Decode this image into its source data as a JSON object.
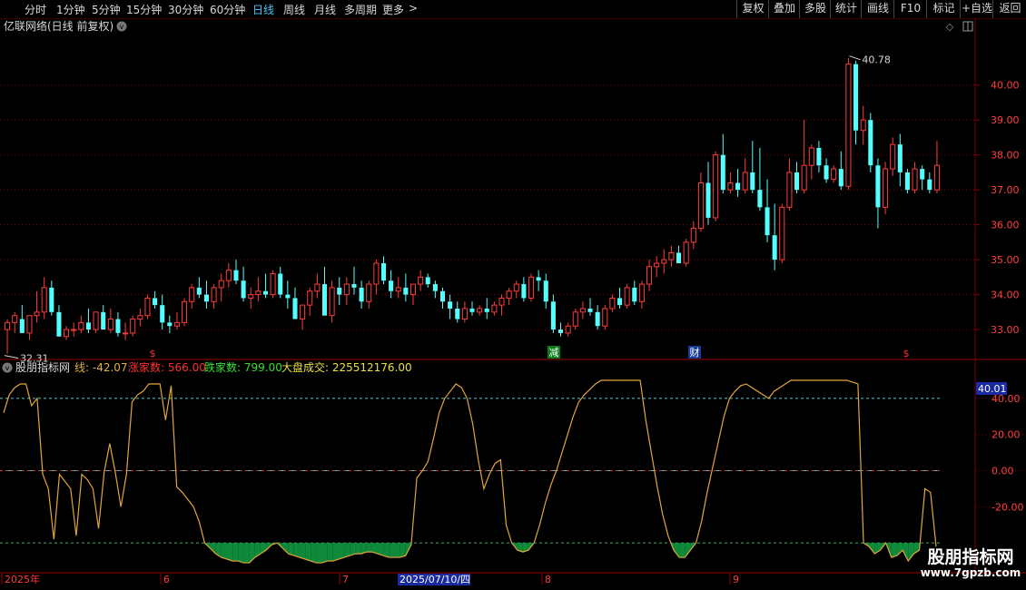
{
  "toolbar": {
    "periods": [
      {
        "label": "分时",
        "active": false
      },
      {
        "label": "1分钟",
        "active": false
      },
      {
        "label": "5分钟",
        "active": false
      },
      {
        "label": "15分钟",
        "active": false
      },
      {
        "label": "30分钟",
        "active": false
      },
      {
        "label": "60分钟",
        "active": false
      },
      {
        "label": "日线",
        "active": true
      },
      {
        "label": "周线",
        "active": false
      },
      {
        "label": "月线",
        "active": false
      },
      {
        "label": "多周期",
        "active": false
      },
      {
        "label": "更多",
        "active": false
      }
    ],
    "more_arrow": ">",
    "buttons": [
      "复权",
      "叠加",
      "多股",
      "统计",
      "画线",
      "F10",
      "标记",
      "+自选",
      "返回"
    ]
  },
  "main_panel": {
    "title": "亿联网络(日线 前复权)",
    "high_marker": "40.78",
    "low_marker": "32.31",
    "events": [
      {
        "label": "$",
        "color": "#ff3030"
      },
      {
        "label": "减",
        "color": "#00c000"
      },
      {
        "label": "财",
        "color": "#3a8bff"
      },
      {
        "label": "$",
        "color": "#ff3030"
      }
    ]
  },
  "indicator_panel": {
    "name": "股朋指标网",
    "items": [
      {
        "label": "线: -42.07",
        "color": "#e0b040"
      },
      {
        "label": "涨家数: 566.00",
        "color": "#ff3030"
      },
      {
        "label": "跌家数: 799.00",
        "color": "#30e030"
      },
      {
        "label": "大盘成交: 225512176.00",
        "color": "#e8e040"
      }
    ],
    "current_value": "40.01"
  },
  "time_axis": {
    "labels": [
      "2025年",
      "6",
      "7",
      "8",
      "9"
    ],
    "cursor_date": "2025/07/10/四"
  },
  "watermark": {
    "title": "股朋指标网",
    "url": "www.7gpzb.com"
  },
  "chart_data": [
    {
      "type": "candlestick",
      "title": "亿联网络(日线 前复权)",
      "ylim": [
        32.3,
        41.5
      ],
      "yticks": [
        33.0,
        34.0,
        35.0,
        36.0,
        37.0,
        38.0,
        39.0,
        40.0
      ],
      "colors": {
        "up": "#ff3c3c",
        "down": "#54ffff"
      },
      "ohlc": [
        [
          33.0,
          33.3,
          32.31,
          33.2
        ],
        [
          33.2,
          33.5,
          32.9,
          33.4
        ],
        [
          33.3,
          33.7,
          32.9,
          32.9
        ],
        [
          32.9,
          33.4,
          32.7,
          33.4
        ],
        [
          33.4,
          34.1,
          33.2,
          33.5
        ],
        [
          33.5,
          34.5,
          33.3,
          34.2
        ],
        [
          34.2,
          34.4,
          33.4,
          33.5
        ],
        [
          33.5,
          33.7,
          32.8,
          32.8
        ],
        [
          32.8,
          33.1,
          32.7,
          33.0
        ],
        [
          33.0,
          33.2,
          32.8,
          33.0
        ],
        [
          33.0,
          33.4,
          32.9,
          33.2
        ],
        [
          33.2,
          33.6,
          32.9,
          33.0
        ],
        [
          33.0,
          33.5,
          32.9,
          33.5
        ],
        [
          33.5,
          33.7,
          33.0,
          33.0
        ],
        [
          33.0,
          33.6,
          32.9,
          33.3
        ],
        [
          33.3,
          33.5,
          32.8,
          32.9
        ],
        [
          32.9,
          33.2,
          32.7,
          32.9
        ],
        [
          32.9,
          33.4,
          32.8,
          33.3
        ],
        [
          33.3,
          33.6,
          33.1,
          33.4
        ],
        [
          33.4,
          34.0,
          33.3,
          33.9
        ],
        [
          33.9,
          34.1,
          33.6,
          33.7
        ],
        [
          33.7,
          34.0,
          33.0,
          33.2
        ],
        [
          33.2,
          33.4,
          32.9,
          33.1
        ],
        [
          33.1,
          33.5,
          33.0,
          33.2
        ],
        [
          33.2,
          33.9,
          33.1,
          33.8
        ],
        [
          33.8,
          34.3,
          33.6,
          34.2
        ],
        [
          34.2,
          34.5,
          33.9,
          34.0
        ],
        [
          34.0,
          34.4,
          33.6,
          33.8
        ],
        [
          33.8,
          34.3,
          33.6,
          34.2
        ],
        [
          34.2,
          34.6,
          33.8,
          34.4
        ],
        [
          34.4,
          34.9,
          34.2,
          34.7
        ],
        [
          34.7,
          35.0,
          34.3,
          34.4
        ],
        [
          34.4,
          34.8,
          33.8,
          33.9
        ],
        [
          33.9,
          34.2,
          33.6,
          34.0
        ],
        [
          34.0,
          34.5,
          33.8,
          34.1
        ],
        [
          34.1,
          34.6,
          33.9,
          34.0
        ],
        [
          34.0,
          34.7,
          33.9,
          34.6
        ],
        [
          34.6,
          34.8,
          33.9,
          34.0
        ],
        [
          34.0,
          34.4,
          33.6,
          33.9
        ],
        [
          33.9,
          34.2,
          33.3,
          33.3
        ],
        [
          33.3,
          33.7,
          33.0,
          33.7
        ],
        [
          33.7,
          34.2,
          33.4,
          34.1
        ],
        [
          34.1,
          34.6,
          33.9,
          34.3
        ],
        [
          34.3,
          34.8,
          33.4,
          33.4
        ],
        [
          33.4,
          34.4,
          33.2,
          34.2
        ],
        [
          34.2,
          34.5,
          33.7,
          34.0
        ],
        [
          34.0,
          34.5,
          33.7,
          34.3
        ],
        [
          34.3,
          34.8,
          34.0,
          34.2
        ],
        [
          34.2,
          34.4,
          33.6,
          33.8
        ],
        [
          33.8,
          34.4,
          33.6,
          34.3
        ],
        [
          34.3,
          35.0,
          34.0,
          34.9
        ],
        [
          34.9,
          35.1,
          34.3,
          34.4
        ],
        [
          34.4,
          34.7,
          33.9,
          34.1
        ],
        [
          34.1,
          34.5,
          33.9,
          34.2
        ],
        [
          34.2,
          34.6,
          33.8,
          34.0
        ],
        [
          34.0,
          34.3,
          33.7,
          34.3
        ],
        [
          34.3,
          34.7,
          34.1,
          34.5
        ],
        [
          34.5,
          34.6,
          34.2,
          34.3
        ],
        [
          34.3,
          34.4,
          33.9,
          34.1
        ],
        [
          34.1,
          34.2,
          33.6,
          33.8
        ],
        [
          33.8,
          34.0,
          33.3,
          33.6
        ],
        [
          33.6,
          33.8,
          33.2,
          33.3
        ],
        [
          33.3,
          33.8,
          33.2,
          33.6
        ],
        [
          33.6,
          33.8,
          33.4,
          33.5
        ],
        [
          33.5,
          33.7,
          33.4,
          33.6
        ],
        [
          33.6,
          33.9,
          33.3,
          33.5
        ],
        [
          33.5,
          33.8,
          33.4,
          33.7
        ],
        [
          33.7,
          34.0,
          33.4,
          33.9
        ],
        [
          33.9,
          34.2,
          33.7,
          34.1
        ],
        [
          34.1,
          34.4,
          33.9,
          34.3
        ],
        [
          34.3,
          34.5,
          33.8,
          33.9
        ],
        [
          33.9,
          34.6,
          33.8,
          34.5
        ],
        [
          34.5,
          34.7,
          34.1,
          34.4
        ],
        [
          34.4,
          34.6,
          33.6,
          33.8
        ],
        [
          33.8,
          34.0,
          32.9,
          33.0
        ],
        [
          33.0,
          33.2,
          32.8,
          32.9
        ],
        [
          32.9,
          33.2,
          32.8,
          33.1
        ],
        [
          33.1,
          33.6,
          33.0,
          33.5
        ],
        [
          33.5,
          33.8,
          33.3,
          33.6
        ],
        [
          33.6,
          33.9,
          33.4,
          33.5
        ],
        [
          33.5,
          33.7,
          33.0,
          33.1
        ],
        [
          33.1,
          33.7,
          33.0,
          33.6
        ],
        [
          33.6,
          34.0,
          33.5,
          33.9
        ],
        [
          33.9,
          34.2,
          33.6,
          33.7
        ],
        [
          33.7,
          34.3,
          33.6,
          34.2
        ],
        [
          34.2,
          34.4,
          33.7,
          33.8
        ],
        [
          33.8,
          34.4,
          33.6,
          34.3
        ],
        [
          34.3,
          35.0,
          34.1,
          34.8
        ],
        [
          34.8,
          35.1,
          34.5,
          34.9
        ],
        [
          34.9,
          35.3,
          34.6,
          35.0
        ],
        [
          35.0,
          35.4,
          34.8,
          35.2
        ],
        [
          35.2,
          35.4,
          34.9,
          34.9
        ],
        [
          34.9,
          35.6,
          34.8,
          35.5
        ],
        [
          35.5,
          36.1,
          35.3,
          35.9
        ],
        [
          35.9,
          37.5,
          35.8,
          37.2
        ],
        [
          37.2,
          37.8,
          36.0,
          36.2
        ],
        [
          36.2,
          38.1,
          36.1,
          38.0
        ],
        [
          38.0,
          38.6,
          36.9,
          37.0
        ],
        [
          37.0,
          37.5,
          36.9,
          37.2
        ],
        [
          37.2,
          37.6,
          36.8,
          37.0
        ],
        [
          37.0,
          37.9,
          36.9,
          37.5
        ],
        [
          37.5,
          38.4,
          36.9,
          37.0
        ],
        [
          37.0,
          38.2,
          36.4,
          36.5
        ],
        [
          36.5,
          37.3,
          35.5,
          35.7
        ],
        [
          35.7,
          36.6,
          34.7,
          35.0
        ],
        [
          35.0,
          36.6,
          34.9,
          36.5
        ],
        [
          36.5,
          37.9,
          36.4,
          37.5
        ],
        [
          37.5,
          37.8,
          36.9,
          37.0
        ],
        [
          37.0,
          39.0,
          36.9,
          37.7
        ],
        [
          37.7,
          38.3,
          37.3,
          38.2
        ],
        [
          38.2,
          38.4,
          37.5,
          37.7
        ],
        [
          37.7,
          37.9,
          37.2,
          37.3
        ],
        [
          37.3,
          37.7,
          37.2,
          37.6
        ],
        [
          37.6,
          38.1,
          37.0,
          37.1
        ],
        [
          37.1,
          40.78,
          37.0,
          40.6
        ],
        [
          40.6,
          40.7,
          38.3,
          38.7
        ],
        [
          38.7,
          39.4,
          38.3,
          39.0
        ],
        [
          39.0,
          39.2,
          37.5,
          37.7
        ],
        [
          37.7,
          37.9,
          35.9,
          36.5
        ],
        [
          36.5,
          37.8,
          36.3,
          37.6
        ],
        [
          37.6,
          38.5,
          37.4,
          38.3
        ],
        [
          38.3,
          38.6,
          37.1,
          37.5
        ],
        [
          37.5,
          37.6,
          36.9,
          37.0
        ],
        [
          37.0,
          37.8,
          36.9,
          37.6
        ],
        [
          37.6,
          37.7,
          37.0,
          37.3
        ],
        [
          37.3,
          37.5,
          36.9,
          37.0
        ],
        [
          37.0,
          38.4,
          36.9,
          37.7
        ]
      ]
    },
    {
      "type": "line",
      "title": "股朋指标网",
      "ylim": [
        -56,
        51
      ],
      "yticks": [
        40.0,
        20.0,
        0.0,
        -20.0
      ],
      "reference_lines": [
        40,
        0,
        -40
      ],
      "fill_below": -40,
      "colors": {
        "line": "#e2a63a",
        "fill": "#0f8a3a"
      },
      "series": [
        {
          "values": [
            32,
            42,
            46,
            48,
            48,
            36,
            40,
            -2,
            -10,
            -38,
            -2,
            -6,
            -10,
            -36,
            -2,
            -5,
            -10,
            -32,
            -1,
            15,
            -1,
            -20,
            -2,
            38,
            42,
            44,
            48,
            48,
            48,
            28,
            47,
            -9,
            -12,
            -16,
            -20,
            -28,
            -40,
            -43,
            -46,
            -48,
            -49,
            -50,
            -50,
            -51,
            -51,
            -48,
            -46,
            -44,
            -41,
            -40,
            -43,
            -46,
            -47,
            -48,
            -49,
            -50,
            -51,
            -51,
            -50,
            -50,
            -49,
            -48,
            -47,
            -46,
            -46,
            -45,
            -45,
            -46,
            -47,
            -48,
            -48,
            -48,
            -47,
            -41,
            -4,
            0,
            5,
            18,
            32,
            40,
            44,
            48,
            46,
            40,
            26,
            6,
            -10,
            -2,
            4,
            6,
            -30,
            -40,
            -44,
            -45,
            -44,
            -40,
            -30,
            -18,
            -8,
            0,
            10,
            20,
            30,
            38,
            42,
            45,
            48,
            50,
            50,
            50,
            50,
            50,
            50,
            50,
            50,
            28,
            10,
            -8,
            -24,
            -36,
            -44,
            -48,
            -48,
            -44,
            -40,
            -28,
            -12,
            2,
            16,
            30,
            40,
            44,
            47,
            48,
            46,
            44,
            42,
            40,
            44,
            46,
            48,
            50,
            50,
            50,
            50,
            50,
            50,
            50,
            50,
            50,
            50,
            50,
            49,
            48,
            -40,
            -42,
            -46,
            -44,
            -40,
            -48,
            -47,
            -44,
            -50,
            -46,
            -44,
            -10,
            -12,
            -42
          ]
        }
      ]
    }
  ]
}
